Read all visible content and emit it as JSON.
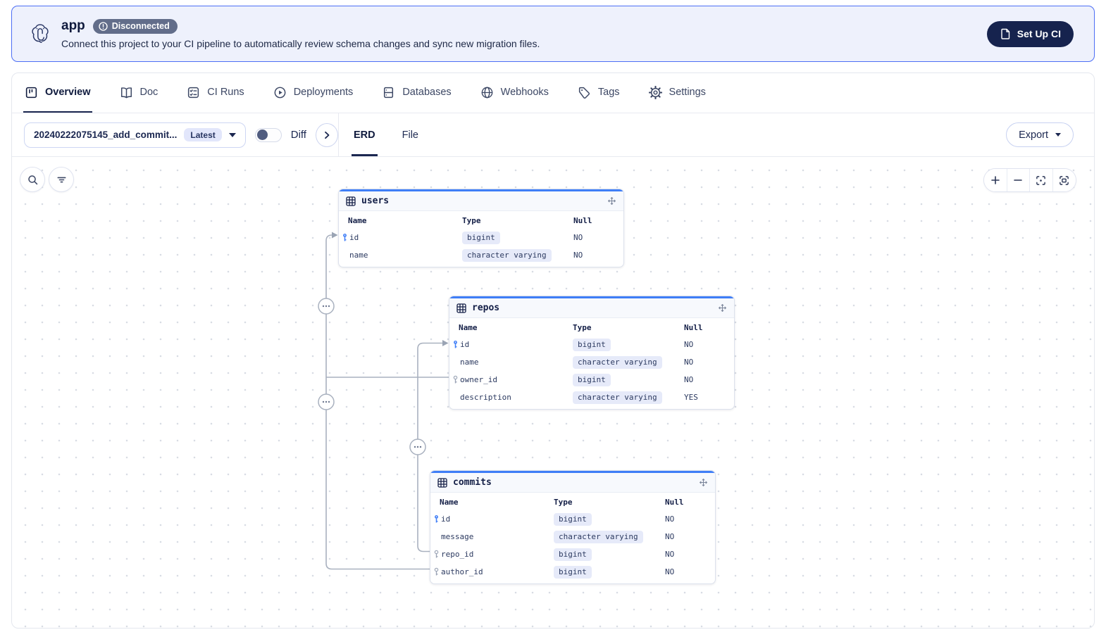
{
  "banner": {
    "title": "app",
    "status": "Disconnected",
    "message": "Connect this project to your CI pipeline to automatically review schema changes and sync new migration files.",
    "cta": "Set Up CI"
  },
  "nav": {
    "tabs": [
      {
        "label": "Overview",
        "active": true
      },
      {
        "label": "Doc",
        "active": false
      },
      {
        "label": "CI Runs",
        "active": false
      },
      {
        "label": "Deployments",
        "active": false
      },
      {
        "label": "Databases",
        "active": false
      },
      {
        "label": "Webhooks",
        "active": false
      },
      {
        "label": "Tags",
        "active": false
      },
      {
        "label": "Settings",
        "active": false
      }
    ]
  },
  "toolbar": {
    "migration": {
      "value": "20240222075145_add_commit...",
      "badge": "Latest"
    },
    "diff_label": "Diff",
    "view_tabs": [
      {
        "label": "ERD",
        "active": true
      },
      {
        "label": "File",
        "active": false
      }
    ],
    "export_label": "Export"
  },
  "erd": {
    "tables": [
      {
        "name": "users",
        "headers": {
          "name": "Name",
          "type": "Type",
          "null": "Null"
        },
        "rows": [
          {
            "name": "id",
            "type": "bigint",
            "null": "NO",
            "key": "primary"
          },
          {
            "name": "name",
            "type": "character varying",
            "null": "NO",
            "key": ""
          }
        ]
      },
      {
        "name": "repos",
        "headers": {
          "name": "Name",
          "type": "Type",
          "null": "Null"
        },
        "rows": [
          {
            "name": "id",
            "type": "bigint",
            "null": "NO",
            "key": "primary"
          },
          {
            "name": "name",
            "type": "character varying",
            "null": "NO",
            "key": ""
          },
          {
            "name": "owner_id",
            "type": "bigint",
            "null": "NO",
            "key": "foreign"
          },
          {
            "name": "description",
            "type": "character varying",
            "null": "YES",
            "key": ""
          }
        ]
      },
      {
        "name": "commits",
        "headers": {
          "name": "Name",
          "type": "Type",
          "null": "Null"
        },
        "rows": [
          {
            "name": "id",
            "type": "bigint",
            "null": "NO",
            "key": "primary"
          },
          {
            "name": "message",
            "type": "character varying",
            "null": "NO",
            "key": ""
          },
          {
            "name": "repo_id",
            "type": "bigint",
            "null": "NO",
            "key": "foreign"
          },
          {
            "name": "author_id",
            "type": "bigint",
            "null": "NO",
            "key": "foreign"
          }
        ]
      }
    ],
    "relations": [
      {
        "from": "repos.owner_id",
        "to": "users.id"
      },
      {
        "from": "commits.author_id",
        "to": "users.id"
      },
      {
        "from": "commits.repo_id",
        "to": "repos.id"
      }
    ]
  },
  "colors": {
    "accent_blue": "#3f7ef7",
    "navy": "#16234e",
    "banner_bg": "#eef1fc",
    "banner_border": "#4c6ef5",
    "badge_bg": "#626d8a",
    "type_pill_bg": "#e6eaf9",
    "edge_gray": "#a9b1bf"
  }
}
